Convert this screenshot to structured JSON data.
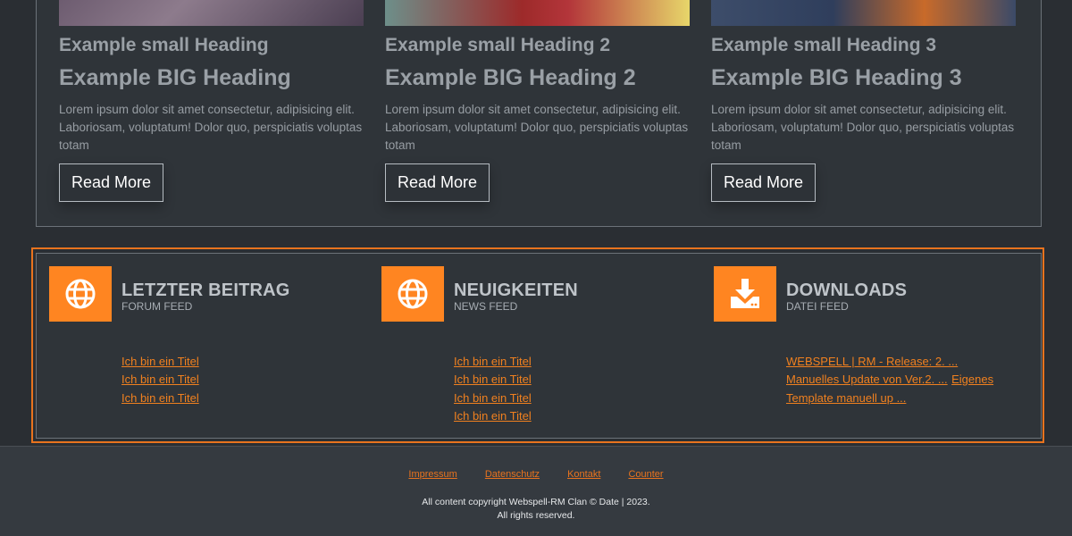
{
  "cards": [
    {
      "small_heading": "Example small Heading",
      "big_heading": "Example BIG Heading",
      "text": "Lorem ipsum dolor sit amet consectetur, adipisicing elit. Laboriosam, voluptatum! Dolor quo, perspiciatis voluptas totam",
      "button_label": "Read More"
    },
    {
      "small_heading": "Example small Heading 2",
      "big_heading": "Example BIG Heading 2",
      "text": "Lorem ipsum dolor sit amet consectetur, adipisicing elit. Laboriosam, voluptatum! Dolor quo, perspiciatis voluptas totam",
      "button_label": "Read More"
    },
    {
      "small_heading": "Example small Heading 3",
      "big_heading": "Example BIG Heading 3",
      "text": "Lorem ipsum dolor sit amet consectetur, adipisicing elit. Laboriosam, voluptatum! Dolor quo, perspiciatis voluptas totam",
      "button_label": "Read More"
    }
  ],
  "feeds": [
    {
      "icon": "globe-icon",
      "title": "LETZTER BEITRAG",
      "subtitle": "FORUM FEED",
      "links": [
        "Ich bin ein Titel",
        "Ich bin ein Titel",
        "Ich bin ein Titel"
      ]
    },
    {
      "icon": "globe-icon",
      "title": "NEUIGKEITEN",
      "subtitle": "NEWS FEED",
      "links": [
        "Ich bin ein Titel",
        "Ich bin ein Titel",
        "Ich bin ein Titel",
        "Ich bin ein Titel"
      ]
    },
    {
      "icon": "download-icon",
      "title": "DOWNLOADS",
      "subtitle": "DATEI FEED",
      "links": [
        "WEBSPELL | RM - Release: 2. ...",
        "Manuelles Update von Ver.2. ...",
        "Eigenes",
        "Template manuell up ..."
      ]
    }
  ],
  "footer": {
    "links": [
      "Impressum",
      "Datenschutz",
      "Kontakt",
      "Counter"
    ],
    "copyright_line1": "All content copyright Webspell-RM Clan © Date | 2023.",
    "copyright_line2": "All rights reserved."
  },
  "colors": {
    "accent": "#ff8521",
    "frame": "#e8731e",
    "background": "#2a2e33"
  }
}
